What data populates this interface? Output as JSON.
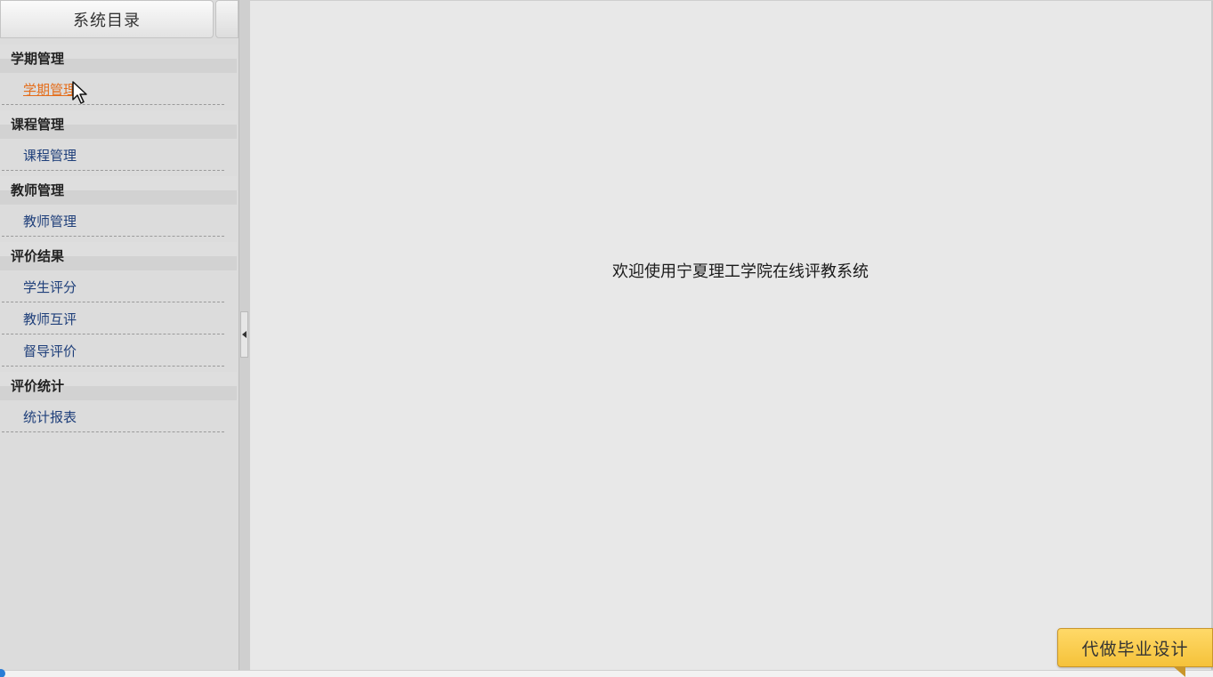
{
  "sidebar": {
    "title": "系统目录",
    "groups": [
      {
        "label": "学期管理",
        "items": [
          {
            "label": "学期管理",
            "active": true
          }
        ]
      },
      {
        "label": "课程管理",
        "items": [
          {
            "label": "课程管理",
            "active": false
          }
        ]
      },
      {
        "label": "教师管理",
        "items": [
          {
            "label": "教师管理",
            "active": false
          }
        ]
      },
      {
        "label": "评价结果",
        "items": [
          {
            "label": "学生评分",
            "active": false
          },
          {
            "label": "教师互评",
            "active": false
          },
          {
            "label": "督导评价",
            "active": false
          }
        ]
      },
      {
        "label": "评价统计",
        "items": [
          {
            "label": "统计报表",
            "active": false
          }
        ]
      }
    ]
  },
  "main": {
    "welcome_text": "欢迎使用宁夏理工学院在线评教系统"
  },
  "ad_badge": {
    "label": "代做毕业设计"
  },
  "colors": {
    "link": "#1f3f7a",
    "link_active": "#e46d1a",
    "badge": "#f5c23a"
  },
  "icons": {
    "splitter": "collapse-left-arrow-icon",
    "cursor": "mouse-pointer-icon"
  }
}
